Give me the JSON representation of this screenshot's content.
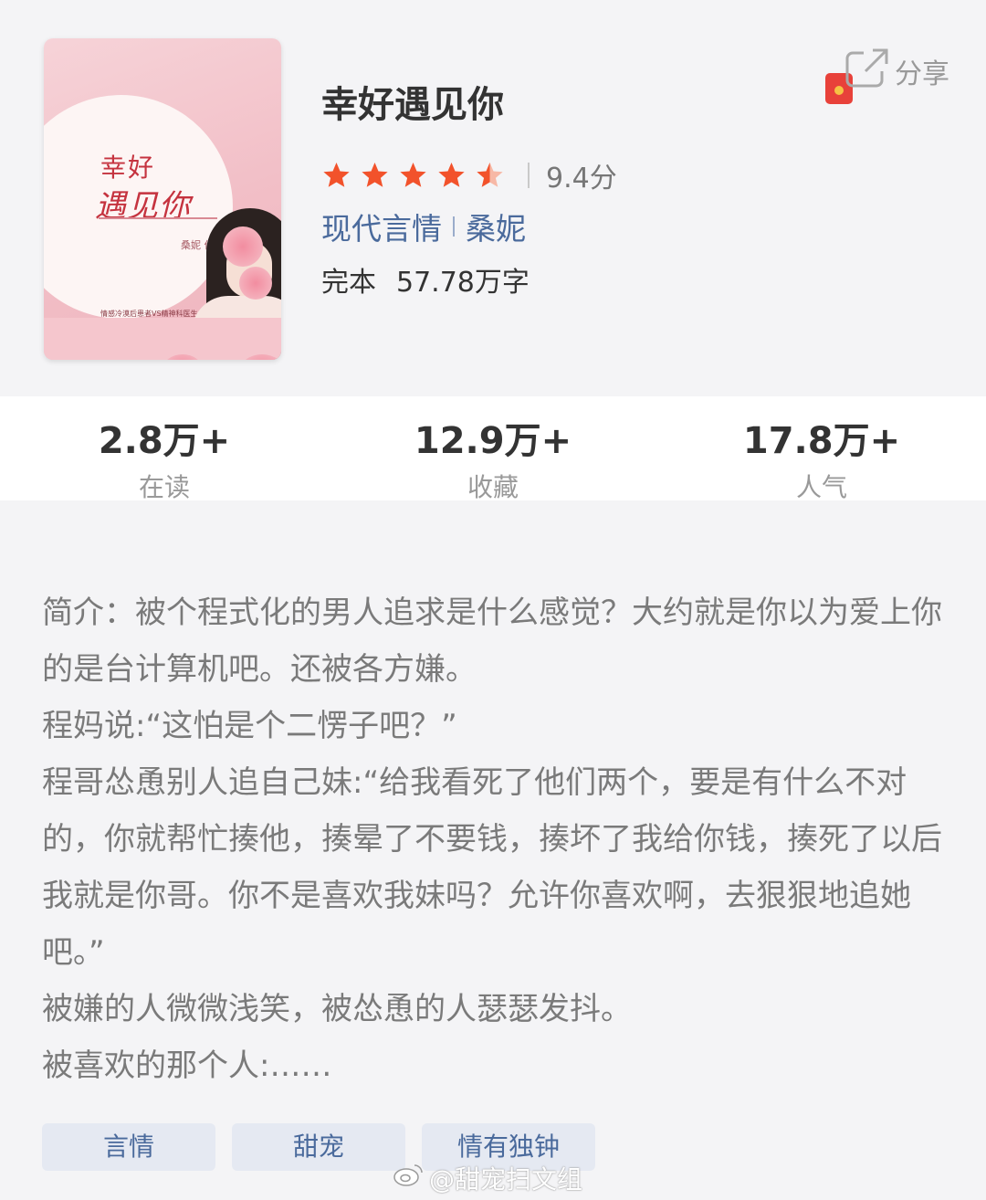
{
  "book": {
    "title": "幸好遇见你",
    "rating": {
      "stars": 4.5,
      "max": 5,
      "score": "9.4分"
    },
    "category": "现代言情",
    "author": "桑妮",
    "status": "完本",
    "word_count": "57.78万字",
    "cover": {
      "title_line1": "幸好",
      "title_line2": "遇见你",
      "author": "桑妮 作品",
      "blurb": "情感冷漠后患者VS精神科医生"
    }
  },
  "share": {
    "label": "分享"
  },
  "stats": [
    {
      "value": "2.8万+",
      "label": "在读"
    },
    {
      "value": "12.9万+",
      "label": "收藏"
    },
    {
      "value": "17.8万+",
      "label": "人气"
    }
  ],
  "intro": {
    "lines": [
      "简介：被个程式化的男人追求是什么感觉？大约就是你以为爱上你的是台计算机吧。还被各方嫌。",
      "程妈说:“这怕是个二愣子吧？”",
      "程哥怂恿别人追自己妹:“给我看死了他们两个，要是有什么不对的，你就帮忙揍他，揍晕了不要钱，揍坏了我给你钱，揍死了以后我就是你哥。你不是喜欢我妹吗？允许你喜欢啊，去狠狠地追她吧。”",
      "被嫌的人微微浅笑，被怂恿的人瑟瑟发抖。",
      "被喜欢的那个人:……"
    ]
  },
  "tags": [
    "言情",
    "甜宠",
    "情有独钟"
  ],
  "watermark": "@甜宠扫文组",
  "colors": {
    "star": "#f2522b",
    "link": "#4a6a9c",
    "tag_bg": "#e5e9f2"
  }
}
